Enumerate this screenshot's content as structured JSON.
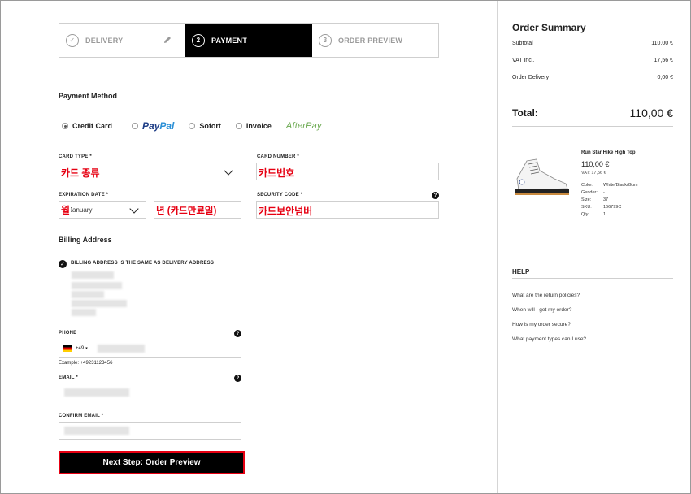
{
  "steps": [
    {
      "num": "✓",
      "label": "DELIVERY"
    },
    {
      "num": "2",
      "label": "PAYMENT"
    },
    {
      "num": "3",
      "label": "ORDER PREVIEW"
    }
  ],
  "payment_method": {
    "title": "Payment Method",
    "options": [
      {
        "label": "Credit Card",
        "selected": true
      },
      {
        "label_a": "Pay",
        "label_b": "Pal",
        "selected": false
      },
      {
        "label": "Sofort",
        "selected": false
      },
      {
        "label": "Invoice",
        "selected": false
      },
      {
        "label": "AfterPay",
        "selected": false
      }
    ]
  },
  "fields": {
    "card_type_label": "CARD TYPE *",
    "card_type_overlay": "카드 종류",
    "card_number_label": "CARD NUMBER *",
    "card_number_overlay": "카드번호",
    "expiration_label": "EXPIRATION DATE *",
    "month_value": "January",
    "month_overlay": "월",
    "year_overlay": "년 (카드만료일)",
    "security_label": "SECURITY CODE *",
    "security_overlay": "카드보안넘버"
  },
  "billing": {
    "title": "Billing Address",
    "same_as_delivery": "BILLING ADDRESS IS THE SAME AS DELIVERY ADDRESS"
  },
  "phone": {
    "label": "PHONE",
    "country_code": "+49",
    "example": "Example: +49231123456"
  },
  "email": {
    "label": "EMAIL *",
    "confirm_label": "CONFIRM EMAIL *"
  },
  "next_button": "Next Step: Order Preview",
  "summary": {
    "title": "Order Summary",
    "subtotal_label": "Subtotal",
    "subtotal_value": "110,00 €",
    "vat_label": "VAT Incl.",
    "vat_value": "17,56 €",
    "delivery_label": "Order Delivery",
    "delivery_value": "0,00 €",
    "total_label": "Total:",
    "total_value": "110,00 €"
  },
  "product": {
    "name": "Run Star Hike High Top",
    "price": "110,00 €",
    "vat": "VAT: 17,56 €",
    "attributes": [
      {
        "k": "Color:",
        "v": "White/Black/Gum"
      },
      {
        "k": "Gender:",
        "v": "-"
      },
      {
        "k": "Size:",
        "v": "37"
      },
      {
        "k": "SKU:",
        "v": "166799C"
      },
      {
        "k": "Qty:",
        "v": "1"
      }
    ]
  },
  "help": {
    "title": "HELP",
    "links": [
      "What are the return policies?",
      "When will I get my order?",
      "How is my order secure?",
      "What payment types can I use?"
    ]
  },
  "colors": {
    "accent_red": "#e60012",
    "black": "#000000",
    "paypal_dark": "#1f3e87",
    "paypal_light": "#2a8fd6",
    "afterpay_green": "#6aa84f"
  }
}
